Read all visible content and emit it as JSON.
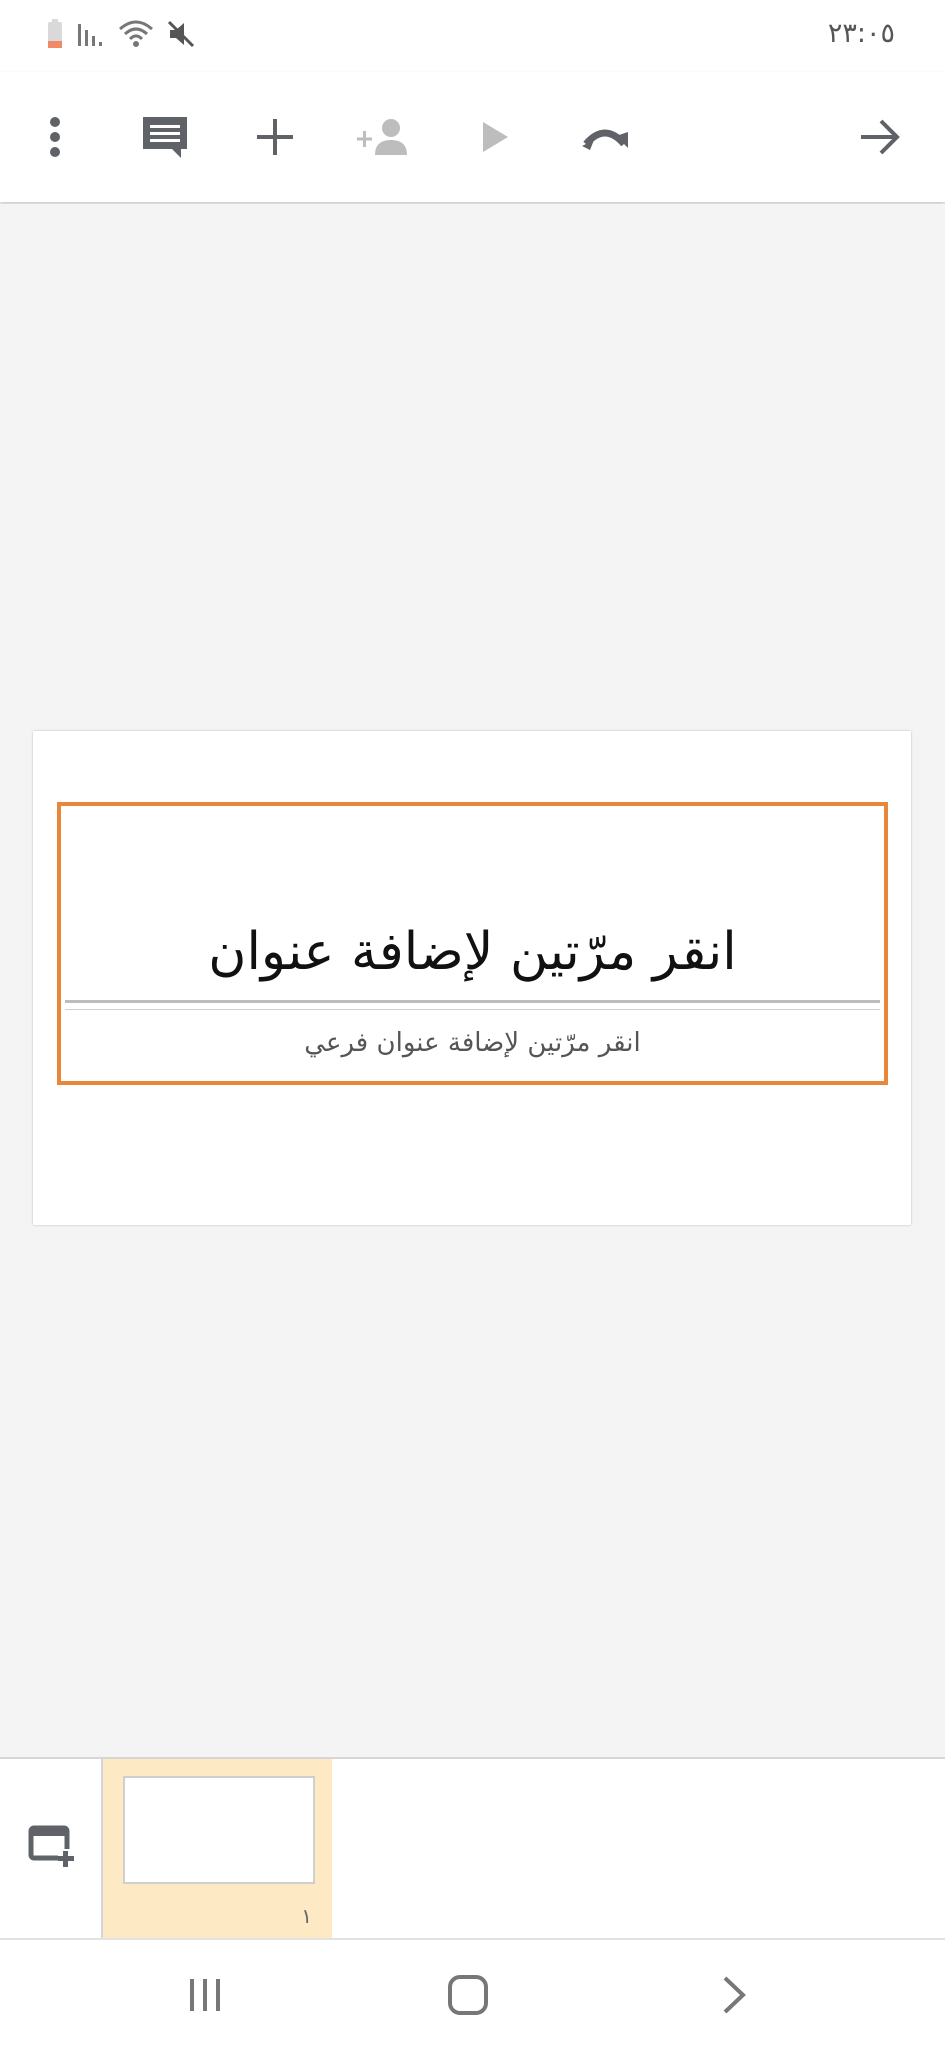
{
  "status_bar": {
    "time": "٢٣:٠٥",
    "icons": [
      "battery-icon",
      "signal-icon",
      "wifi-icon",
      "mute-icon"
    ]
  },
  "toolbar": {
    "buttons": [
      {
        "icon": "more-vert-icon",
        "label": "More options"
      },
      {
        "icon": "comment-icon",
        "label": "Comments"
      },
      {
        "icon": "add-icon",
        "label": "Insert"
      },
      {
        "icon": "add-person-icon",
        "label": "Share"
      },
      {
        "icon": "play-icon",
        "label": "Present"
      },
      {
        "icon": "redo-icon",
        "label": "Redo"
      },
      {
        "icon": "arrow-forward-icon",
        "label": "Back"
      }
    ]
  },
  "slide": {
    "title_placeholder": "انقر مرّتين لإضافة عنوان",
    "subtitle_placeholder": "انقر مرّتين لإضافة عنوان فرعي"
  },
  "filmstrip": {
    "add_slide_icon": "add-slide-icon",
    "slides": [
      {
        "number": "١",
        "selected": true
      }
    ]
  },
  "colors": {
    "selection": "#e8863a",
    "thumb_selected_bg": "#fde9c4",
    "icon_dark": "#5f6368",
    "icon_disabled": "#bdbdbd"
  },
  "navbar": {
    "buttons": [
      "recents-icon",
      "home-icon",
      "back-icon"
    ]
  }
}
